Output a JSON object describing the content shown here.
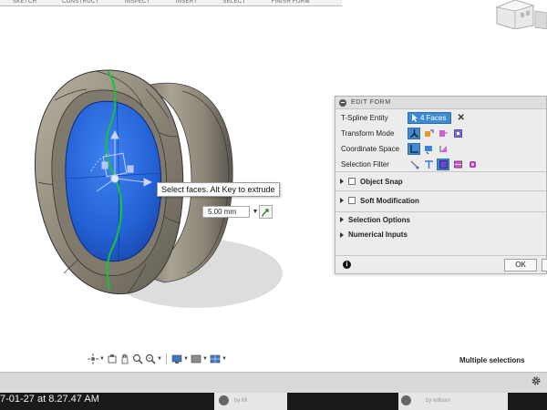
{
  "toolbar": {
    "items": [
      "SKETCH",
      "CONSTRUCT",
      "INSPECT",
      "INSERT",
      "SELECT",
      "FINISH FORM"
    ]
  },
  "viewport": {
    "tooltip": "Select faces. Alt Key to extrude",
    "distance_value": "5.00 mm"
  },
  "edit_form": {
    "title": "EDIT FORM",
    "tspline_entity_label": "T-Spline Entity",
    "selection_count": "4 Faces",
    "transform_mode_label": "Transform Mode",
    "coordinate_space_label": "Coordinate Space",
    "selection_filter_label": "Selection Filter",
    "object_snap_label": "Object Snap",
    "soft_modification_label": "Soft Modification",
    "selection_options_label": "Selection Options",
    "numerical_inputs_label": "Numerical Inputs",
    "ok_label": "OK",
    "info_glyph": "i"
  },
  "status": {
    "text": "Multiple selections"
  },
  "desktop": {
    "timestamp_fragment": "7-01-27 at 8.27.47 AM",
    "thumb1_caption": "by Mi",
    "thumb2_caption": "by wilburn"
  },
  "colors": {
    "accent": "#3f8bd1",
    "selected_face": "#1f5fd6",
    "model_body": "#8a8476",
    "panel_bg": "#ececec"
  }
}
